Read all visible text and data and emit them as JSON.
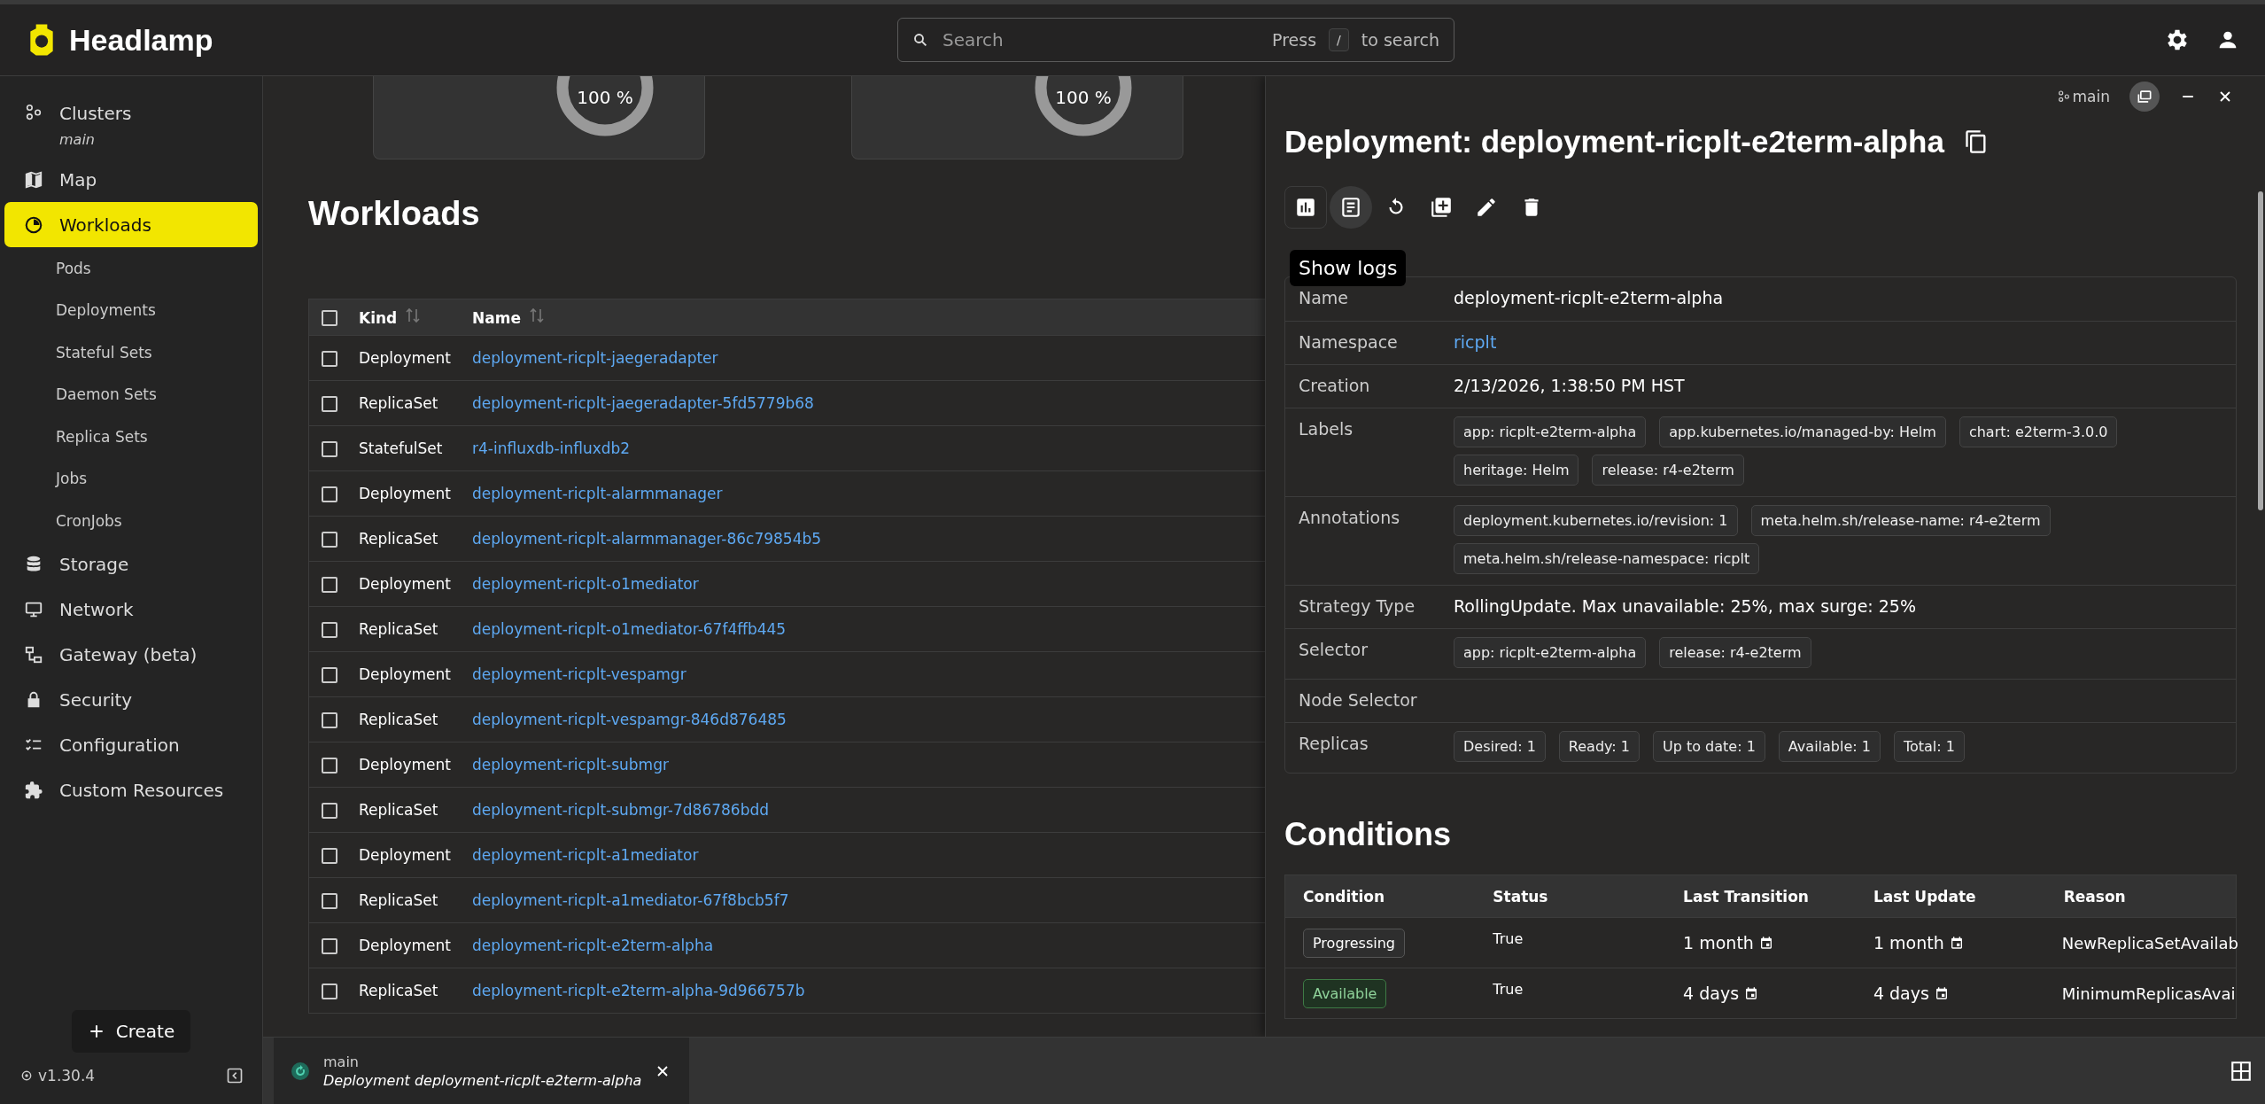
{
  "app": {
    "name": "Headlamp"
  },
  "search": {
    "placeholder": "Search",
    "hint_before": "Press",
    "hint_key": "/",
    "hint_after": "to search"
  },
  "sidebar": {
    "items": [
      {
        "label": "Clusters",
        "sublabel": "main",
        "selected": false
      },
      {
        "label": "Map",
        "selected": false
      },
      {
        "label": "Workloads",
        "selected": true,
        "children": [
          {
            "label": "Pods",
            "selected": false
          },
          {
            "label": "Deployments",
            "selected": false
          },
          {
            "label": "Stateful Sets",
            "selected": false
          },
          {
            "label": "Daemon Sets",
            "selected": false
          },
          {
            "label": "Replica Sets",
            "selected": false
          },
          {
            "label": "Jobs",
            "selected": false
          },
          {
            "label": "CronJobs",
            "selected": false
          }
        ]
      },
      {
        "label": "Storage",
        "selected": false
      },
      {
        "label": "Network",
        "selected": false
      },
      {
        "label": "Gateway (beta)",
        "selected": false
      },
      {
        "label": "Security",
        "selected": false
      },
      {
        "label": "Configuration",
        "selected": false
      },
      {
        "label": "Custom Resources",
        "selected": false
      }
    ],
    "create_button": "Create",
    "version": "v1.30.4"
  },
  "summary_cards": [
    {
      "reading": "100 %"
    },
    {
      "reading": "100 %"
    }
  ],
  "workloads": {
    "title": "Workloads",
    "select_all_checked": false,
    "columns": [
      "Kind",
      "Name"
    ],
    "rows": [
      {
        "kind_label": "Deployment",
        "name": "deployment-ricplt-jaegeradapter",
        "checked": false
      },
      {
        "kind_label": "ReplicaSet",
        "name": "deployment-ricplt-jaegeradapter-5fd5779b68",
        "checked": false
      },
      {
        "kind_label": "StatefulSet",
        "name": "r4-influxdb-influxdb2",
        "checked": false
      },
      {
        "kind_label": "Deployment",
        "name": "deployment-ricplt-alarmmanager",
        "checked": false
      },
      {
        "kind_label": "ReplicaSet",
        "name": "deployment-ricplt-alarmmanager-86c79854b5",
        "checked": false
      },
      {
        "kind_label": "Deployment",
        "name": "deployment-ricplt-o1mediator",
        "checked": false
      },
      {
        "kind_label": "ReplicaSet",
        "name": "deployment-ricplt-o1mediator-67f4ffb445",
        "checked": false
      },
      {
        "kind_label": "Deployment",
        "name": "deployment-ricplt-vespamgr",
        "checked": false
      },
      {
        "kind_label": "ReplicaSet",
        "name": "deployment-ricplt-vespamgr-846d876485",
        "checked": false
      },
      {
        "kind_label": "Deployment",
        "name": "deployment-ricplt-submgr",
        "checked": false
      },
      {
        "kind_label": "ReplicaSet",
        "name": "deployment-ricplt-submgr-7d86786bdd",
        "checked": false
      },
      {
        "kind_label": "Deployment",
        "name": "deployment-ricplt-a1mediator",
        "checked": false
      },
      {
        "kind_label": "ReplicaSet",
        "name": "deployment-ricplt-a1mediator-67f8bcb5f7",
        "checked": false
      },
      {
        "kind_label": "Deployment",
        "name": "deployment-ricplt-e2term-alpha",
        "checked": false
      },
      {
        "kind_label": "ReplicaSet",
        "name": "deployment-ricplt-e2term-alpha-9d966757b",
        "checked": false
      }
    ]
  },
  "detail": {
    "cluster": "main",
    "title": "Deployment: deployment-ricplt-e2term-alpha",
    "actions": [
      {
        "kind": "metrics",
        "focused": true,
        "hovered": false
      },
      {
        "kind": "logs",
        "focused": false,
        "hovered": true
      },
      {
        "kind": "restart",
        "focused": false,
        "hovered": false
      },
      {
        "kind": "clone",
        "focused": false,
        "hovered": false
      },
      {
        "kind": "edit",
        "focused": false,
        "hovered": false
      },
      {
        "kind": "delete",
        "focused": false,
        "hovered": false
      }
    ],
    "tooltip": "Show logs",
    "metadata": [
      {
        "kind": "text",
        "label": "Name",
        "value": "deployment-ricplt-e2term-alpha"
      },
      {
        "kind": "link",
        "label": "Namespace",
        "value": "ricplt"
      },
      {
        "kind": "text",
        "label": "Creation",
        "value": "2/13/2026, 1:38:50 PM HST"
      },
      {
        "kind": "chips",
        "label": "Labels",
        "chips": [
          "app: ricplt-e2term-alpha",
          "app.kubernetes.io/managed-by: Helm",
          "chart: e2term-3.0.0",
          "heritage: Helm",
          "release: r4-e2term"
        ]
      },
      {
        "kind": "chips",
        "label": "Annotations",
        "chips": [
          "deployment.kubernetes.io/revision: 1",
          "meta.helm.sh/release-name: r4-e2term",
          "meta.helm.sh/release-namespace: ricplt"
        ]
      },
      {
        "kind": "text",
        "label": "Strategy Type",
        "value": "RollingUpdate. Max unavailable: 25%, max surge: 25%"
      },
      {
        "kind": "chips",
        "label": "Selector",
        "chips": [
          "app: ricplt-e2term-alpha",
          "release: r4-e2term"
        ]
      },
      {
        "kind": "empty",
        "label": "Node Selector"
      },
      {
        "kind": "chips",
        "label": "Replicas",
        "chips": [
          "Desired: 1",
          "Ready: 1",
          "Up to date: 1",
          "Available: 1",
          "Total: 1"
        ]
      }
    ],
    "conditions": {
      "title": "Conditions",
      "columns": [
        "Condition",
        "Status",
        "Last Transition",
        "Last Update",
        "Reason"
      ],
      "rows": [
        {
          "condition": "Progressing",
          "success": false,
          "status": "True",
          "last_transition": "1 month",
          "last_update": "1 month",
          "reason": "NewReplicaSetAvailab"
        },
        {
          "condition": "Available",
          "success": true,
          "status": "True",
          "last_transition": "4 days",
          "last_update": "4 days",
          "reason": "MinimumReplicasAvai"
        }
      ]
    }
  },
  "bottom_tabs": [
    {
      "cluster": "main",
      "title": "Deployment deployment-ricplt-e2term-alpha"
    }
  ]
}
